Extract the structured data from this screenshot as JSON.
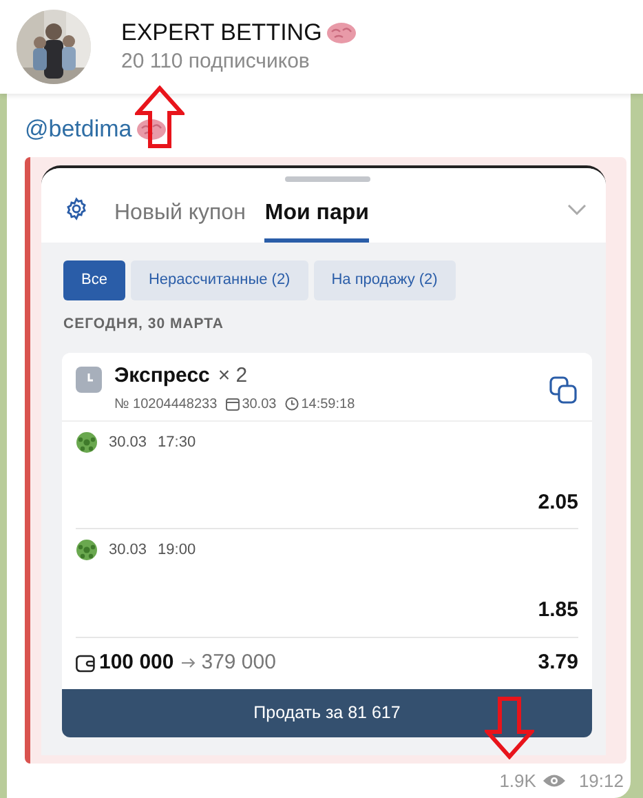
{
  "header": {
    "title": "EXPERT BETTING",
    "subtitle": "20 110 подписчиков"
  },
  "message": {
    "mention": "@betdima",
    "views": "1.9K",
    "time": "19:12"
  },
  "coupon": {
    "tabs": [
      {
        "label": "Новый купон",
        "selected": false
      },
      {
        "label": "Мои пари",
        "selected": true
      }
    ],
    "filters": [
      {
        "label": "Все",
        "selected": true
      },
      {
        "label": "Нерассчитанные (2)",
        "selected": false
      },
      {
        "label": "На продажу (2)",
        "selected": false
      }
    ],
    "date_heading": "СЕГОДНЯ, 30 МАРТА",
    "bet": {
      "title": "Экспресс",
      "multiplier": "× 2",
      "number": "№ 10204448233",
      "date": "30.03",
      "time": "14:59:18",
      "events": [
        {
          "date": "30.03",
          "time": "17:30",
          "odds": "2.05"
        },
        {
          "date": "30.03",
          "time": "19:00",
          "odds": "1.85"
        }
      ],
      "stake": "100 000",
      "payout": "379 000",
      "total_odds": "3.79",
      "sell_button": "Продать за 81 617"
    }
  }
}
